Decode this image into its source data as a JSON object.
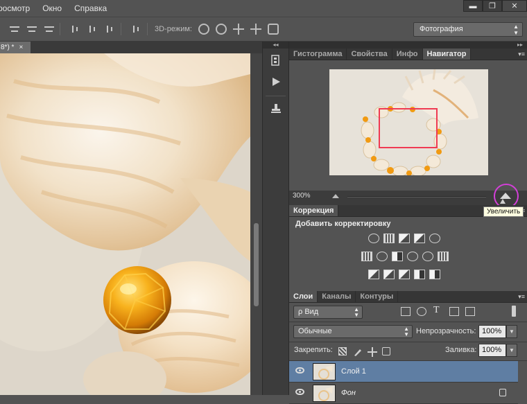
{
  "menu": {
    "items": [
      "росмотр",
      "Окно",
      "Справка"
    ]
  },
  "window_controls": {
    "minimize": "▬",
    "restore": "❐",
    "close": "✕"
  },
  "options_bar": {
    "mode_label": "3D-режим:",
    "workspace": "Фотография"
  },
  "document": {
    "tab_label": "8*) *",
    "tab_close": "×"
  },
  "panels": {
    "navigator_tabs": [
      "Гистограмма",
      "Свойства",
      "Инфо",
      "Навигатор"
    ],
    "active_navigator_tab": "Навигатор",
    "panel_menu": "▾≡",
    "zoom_value": "300%",
    "tooltip": "Увеличить",
    "adjustments_tab": "Коррекция",
    "adjustments_heading": "Добавить корректировку",
    "layers_tabs": [
      "Слои",
      "Каналы",
      "Контуры"
    ],
    "layer_filter": "ρ Вид",
    "blend_mode": "Обычные",
    "opacity_label": "Непрозрачность:",
    "opacity_value": "100%",
    "lock_label": "Закрепить:",
    "fill_label": "Заливка:",
    "fill_value": "100%",
    "layers": [
      {
        "name": "Слой 1",
        "selected": true
      },
      {
        "name": "Фон",
        "selected": false
      }
    ]
  },
  "colors": {
    "panel_bg": "#535353",
    "selected_layer": "#5f7ea3",
    "nav_view_box": "#f03a52",
    "highlight_circle": "#d43fd9",
    "tooltip_bg": "#ffffe1"
  }
}
